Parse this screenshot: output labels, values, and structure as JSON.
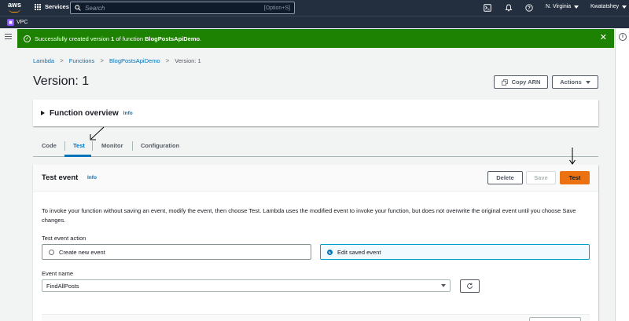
{
  "topnav": {
    "logo": "aws",
    "services_label": "Services",
    "search_placeholder": "Search",
    "search_shortcut": "[Option+S]",
    "region": "N. Virginia",
    "account": "Kwatatshey",
    "icons": [
      "cloudshell-icon",
      "bell-icon",
      "help-icon"
    ]
  },
  "subnav": {
    "service_label": "VPC"
  },
  "flash": {
    "prefix": "Successfully created version ",
    "version": "1",
    "middle": " of function ",
    "function_name": "BlogPostsApiDemo",
    "suffix": "."
  },
  "breadcrumb": [
    "Lambda",
    "Functions",
    "BlogPostsApiDemo",
    "Version: 1"
  ],
  "header": {
    "title": "Version: 1",
    "copy_arn_label": "Copy ARN",
    "actions_label": "Actions"
  },
  "overview": {
    "title": "Function overview",
    "info": "Info"
  },
  "tabs": [
    {
      "label": "Code",
      "active": false
    },
    {
      "label": "Test",
      "active": true
    },
    {
      "label": "Monitor",
      "active": false
    },
    {
      "label": "Configuration",
      "active": false
    }
  ],
  "test_event": {
    "title": "Test event",
    "info": "Info",
    "delete_label": "Delete",
    "save_label": "Save",
    "test_label": "Test",
    "description": "To invoke your function without saving an event, modify the event, then choose Test. Lambda uses the modified event to invoke your function, but does not overwrite the original event until you choose Save changes.",
    "action_label": "Test event action",
    "options": [
      {
        "label": "Create new event",
        "selected": false
      },
      {
        "label": "Edit saved event",
        "selected": true
      }
    ],
    "event_name_label": "Event name",
    "event_name_value": "FindAllPosts"
  },
  "colors": {
    "nav_bg": "#232f3e",
    "flash_success": "#1d8102",
    "link": "#0073bb",
    "primary_button": "#ec7211",
    "vpc_badge": "#8c4fff"
  }
}
